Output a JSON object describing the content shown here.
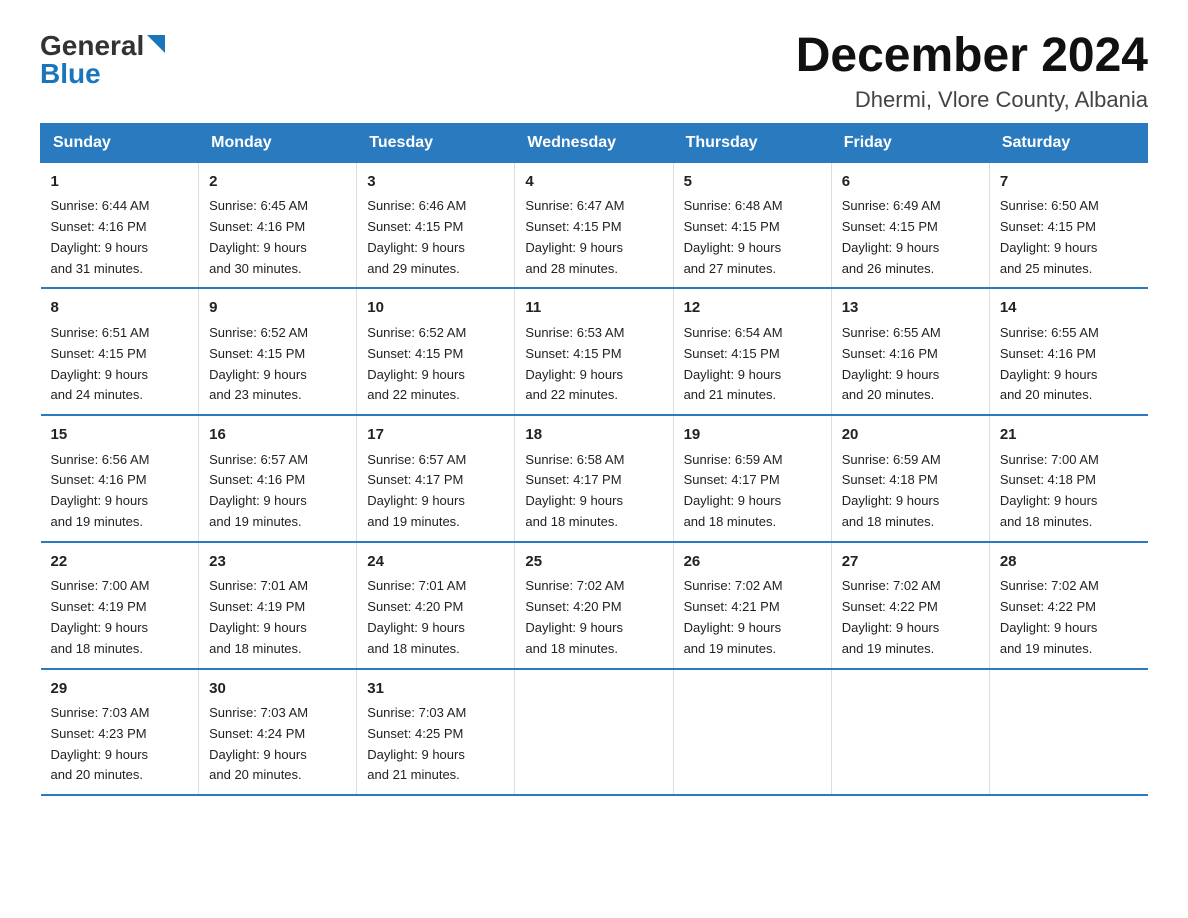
{
  "logo": {
    "general": "General",
    "blue": "Blue"
  },
  "title": "December 2024",
  "subtitle": "Dhermi, Vlore County, Albania",
  "days_of_week": [
    "Sunday",
    "Monday",
    "Tuesday",
    "Wednesday",
    "Thursday",
    "Friday",
    "Saturday"
  ],
  "weeks": [
    [
      {
        "day": "1",
        "sunrise": "6:44 AM",
        "sunset": "4:16 PM",
        "daylight": "9 hours and 31 minutes."
      },
      {
        "day": "2",
        "sunrise": "6:45 AM",
        "sunset": "4:16 PM",
        "daylight": "9 hours and 30 minutes."
      },
      {
        "day": "3",
        "sunrise": "6:46 AM",
        "sunset": "4:15 PM",
        "daylight": "9 hours and 29 minutes."
      },
      {
        "day": "4",
        "sunrise": "6:47 AM",
        "sunset": "4:15 PM",
        "daylight": "9 hours and 28 minutes."
      },
      {
        "day": "5",
        "sunrise": "6:48 AM",
        "sunset": "4:15 PM",
        "daylight": "9 hours and 27 minutes."
      },
      {
        "day": "6",
        "sunrise": "6:49 AM",
        "sunset": "4:15 PM",
        "daylight": "9 hours and 26 minutes."
      },
      {
        "day": "7",
        "sunrise": "6:50 AM",
        "sunset": "4:15 PM",
        "daylight": "9 hours and 25 minutes."
      }
    ],
    [
      {
        "day": "8",
        "sunrise": "6:51 AM",
        "sunset": "4:15 PM",
        "daylight": "9 hours and 24 minutes."
      },
      {
        "day": "9",
        "sunrise": "6:52 AM",
        "sunset": "4:15 PM",
        "daylight": "9 hours and 23 minutes."
      },
      {
        "day": "10",
        "sunrise": "6:52 AM",
        "sunset": "4:15 PM",
        "daylight": "9 hours and 22 minutes."
      },
      {
        "day": "11",
        "sunrise": "6:53 AM",
        "sunset": "4:15 PM",
        "daylight": "9 hours and 22 minutes."
      },
      {
        "day": "12",
        "sunrise": "6:54 AM",
        "sunset": "4:15 PM",
        "daylight": "9 hours and 21 minutes."
      },
      {
        "day": "13",
        "sunrise": "6:55 AM",
        "sunset": "4:16 PM",
        "daylight": "9 hours and 20 minutes."
      },
      {
        "day": "14",
        "sunrise": "6:55 AM",
        "sunset": "4:16 PM",
        "daylight": "9 hours and 20 minutes."
      }
    ],
    [
      {
        "day": "15",
        "sunrise": "6:56 AM",
        "sunset": "4:16 PM",
        "daylight": "9 hours and 19 minutes."
      },
      {
        "day": "16",
        "sunrise": "6:57 AM",
        "sunset": "4:16 PM",
        "daylight": "9 hours and 19 minutes."
      },
      {
        "day": "17",
        "sunrise": "6:57 AM",
        "sunset": "4:17 PM",
        "daylight": "9 hours and 19 minutes."
      },
      {
        "day": "18",
        "sunrise": "6:58 AM",
        "sunset": "4:17 PM",
        "daylight": "9 hours and 18 minutes."
      },
      {
        "day": "19",
        "sunrise": "6:59 AM",
        "sunset": "4:17 PM",
        "daylight": "9 hours and 18 minutes."
      },
      {
        "day": "20",
        "sunrise": "6:59 AM",
        "sunset": "4:18 PM",
        "daylight": "9 hours and 18 minutes."
      },
      {
        "day": "21",
        "sunrise": "7:00 AM",
        "sunset": "4:18 PM",
        "daylight": "9 hours and 18 minutes."
      }
    ],
    [
      {
        "day": "22",
        "sunrise": "7:00 AM",
        "sunset": "4:19 PM",
        "daylight": "9 hours and 18 minutes."
      },
      {
        "day": "23",
        "sunrise": "7:01 AM",
        "sunset": "4:19 PM",
        "daylight": "9 hours and 18 minutes."
      },
      {
        "day": "24",
        "sunrise": "7:01 AM",
        "sunset": "4:20 PM",
        "daylight": "9 hours and 18 minutes."
      },
      {
        "day": "25",
        "sunrise": "7:02 AM",
        "sunset": "4:20 PM",
        "daylight": "9 hours and 18 minutes."
      },
      {
        "day": "26",
        "sunrise": "7:02 AM",
        "sunset": "4:21 PM",
        "daylight": "9 hours and 19 minutes."
      },
      {
        "day": "27",
        "sunrise": "7:02 AM",
        "sunset": "4:22 PM",
        "daylight": "9 hours and 19 minutes."
      },
      {
        "day": "28",
        "sunrise": "7:02 AM",
        "sunset": "4:22 PM",
        "daylight": "9 hours and 19 minutes."
      }
    ],
    [
      {
        "day": "29",
        "sunrise": "7:03 AM",
        "sunset": "4:23 PM",
        "daylight": "9 hours and 20 minutes."
      },
      {
        "day": "30",
        "sunrise": "7:03 AM",
        "sunset": "4:24 PM",
        "daylight": "9 hours and 20 minutes."
      },
      {
        "day": "31",
        "sunrise": "7:03 AM",
        "sunset": "4:25 PM",
        "daylight": "9 hours and 21 minutes."
      },
      null,
      null,
      null,
      null
    ]
  ],
  "labels": {
    "sunrise": "Sunrise:",
    "sunset": "Sunset:",
    "daylight": "Daylight:"
  }
}
